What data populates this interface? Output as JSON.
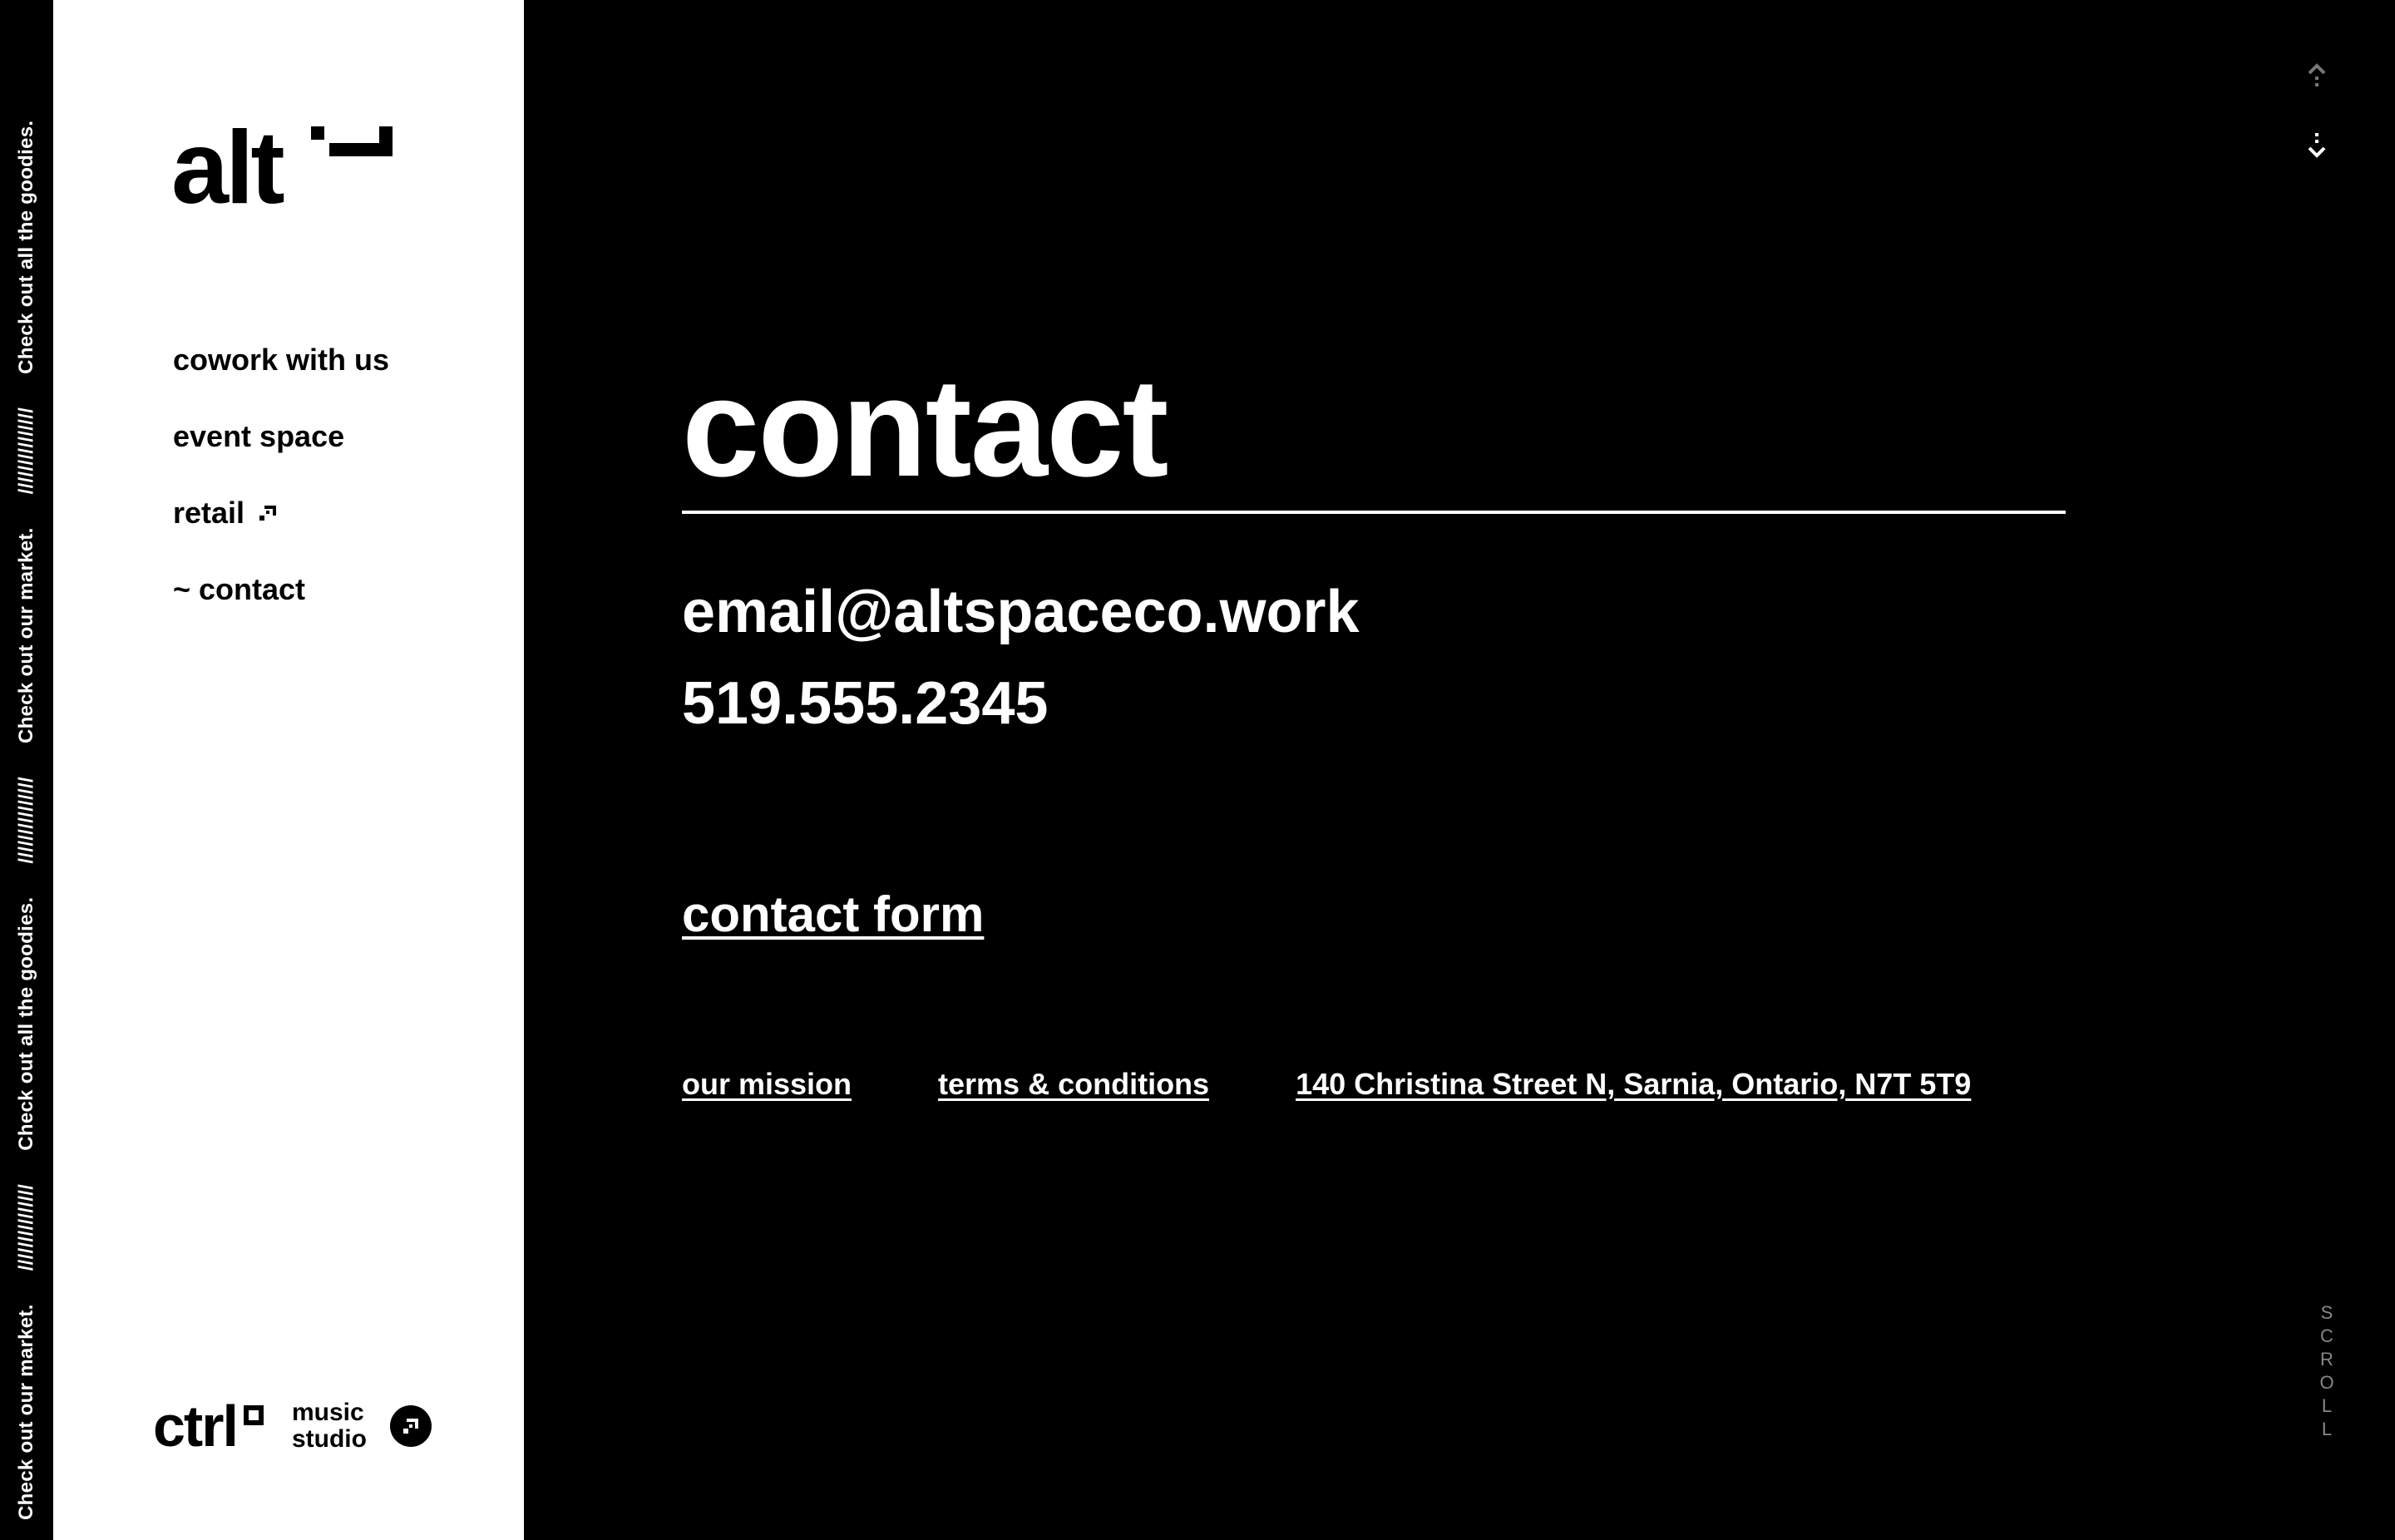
{
  "ticker": {
    "messages": [
      "Check out our market.",
      "///////////////",
      "Check out all the goodies.",
      "///////////////",
      "Check out our market.",
      "///////////////",
      "Check out all the goodies."
    ]
  },
  "sidebar": {
    "logo_text": "alt",
    "nav": [
      {
        "label": "cowork with us"
      },
      {
        "label": "event space"
      },
      {
        "label": "retail"
      },
      {
        "label": "~ contact"
      }
    ],
    "ctrl": {
      "word": "ctrl",
      "line1": "music",
      "line2": "studio"
    }
  },
  "main": {
    "heading": "contact",
    "email": "email@altspaceco.work",
    "phone": "519.555.2345",
    "form_link": "contact form",
    "footer": {
      "mission": "our mission",
      "terms": "terms & conditions",
      "address": "140 Christina Street N, Sarnia, Ontario, N7T 5T9"
    },
    "scroll_letters": [
      "S",
      "C",
      "R",
      "O",
      "L",
      "L"
    ]
  },
  "colors": {
    "background": "#000000",
    "sidebar": "#ffffff",
    "text_light": "#ffffff",
    "muted": "#888888"
  },
  "icons": [
    "external-link-icon",
    "arrow-up-icon",
    "arrow-down-icon",
    "logo-mark-icon"
  ]
}
